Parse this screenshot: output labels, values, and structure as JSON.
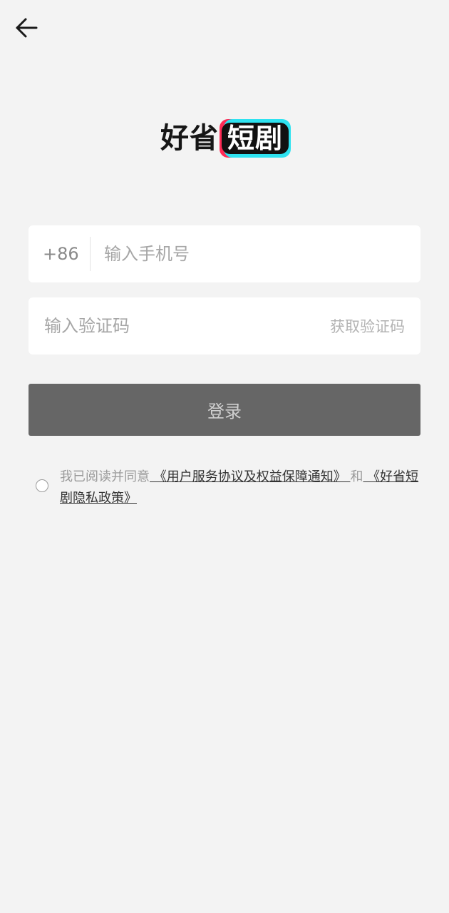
{
  "header": {
    "back_icon": "arrow-left-icon"
  },
  "logo": {
    "plain": "好省",
    "boxed": "短剧"
  },
  "phone": {
    "country_code": "+86",
    "placeholder": "输入手机号"
  },
  "code": {
    "placeholder": "输入验证码",
    "get_code_label": "获取验证码"
  },
  "login": {
    "label": "登录"
  },
  "agreement": {
    "prefix": "我已阅读并同意",
    "link1": " 《用户服务协议及权益保障通知》 ",
    "and": "和",
    "link2": " 《好省短剧隐私政策》 "
  },
  "colors": {
    "background": "#f3f3f3",
    "login_button": "#666666"
  }
}
